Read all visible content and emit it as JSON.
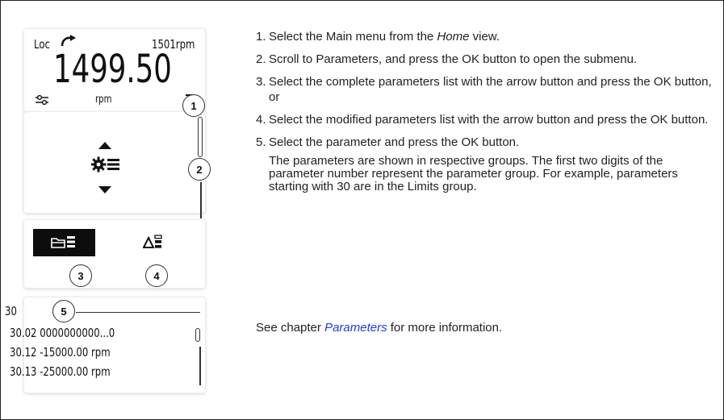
{
  "display": {
    "status": {
      "mode": "Loc",
      "reference": "1501rpm",
      "value": "1499.50",
      "unit": "rpm"
    },
    "callouts": [
      "1",
      "2",
      "3",
      "4",
      "5"
    ],
    "parameter_list": {
      "group": "30",
      "rows": [
        "30.02  0000000000...0",
        "30.12  -15000.00 rpm",
        "30.13  -25000.00 rpm"
      ]
    },
    "icons": {
      "rotation": "rotation-arrow-icon",
      "options": "options-sliders-icon",
      "menu": "menu-icon",
      "parameters": "gear-list-icon",
      "complete_list": "complete-parameters-list-icon",
      "modified_list": "modified-parameters-list-icon"
    }
  },
  "instructions": {
    "step1_pre": "Select the Main menu from the ",
    "step1_em": "Home",
    "step1_post": " view.",
    "step2": "Scroll to Parameters, and press the OK button to open the submenu.",
    "step3": "Select the complete parameters list with the arrow button and press the OK button, or",
    "step4": "Select the modified parameters list with the arrow button and press the OK button.",
    "step5": "Select the parameter and press the OK button.",
    "note": "The parameters are shown in respective groups. The first two digits of the parameter number represent the parameter group. For example, parameters starting with 30 are in the Limits group.",
    "numbers": [
      "1.",
      "2.",
      "3.",
      "4.",
      "5."
    ],
    "see_pre": "See chapter ",
    "see_link": "Parameters",
    "see_post": " for more information."
  },
  "colors": {
    "link": "#1a3de0",
    "border": "#222222",
    "selected_bg": "#0d0d0d"
  }
}
